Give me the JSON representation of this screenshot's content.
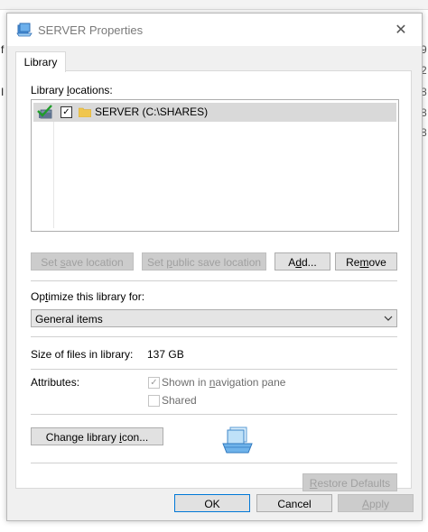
{
  "background_window": {
    "left_chars": [
      "f",
      "I"
    ],
    "right_chars": [
      "9",
      "2",
      "8",
      "8",
      "8"
    ]
  },
  "window": {
    "title": "SERVER Properties",
    "close_glyph": "✕"
  },
  "tabs": [
    {
      "label": "Library"
    }
  ],
  "library": {
    "locations_label_pre": "Library ",
    "locations_label_accel": "l",
    "locations_label_post": "ocations:",
    "items": [
      {
        "checked": true,
        "label": "SERVER (C:\\SHARES)"
      }
    ],
    "buttons": {
      "set_save_pre": "Set ",
      "set_save_accel": "s",
      "set_save_post": "ave location",
      "set_public_pre": "Set ",
      "set_public_accel": "p",
      "set_public_post": "ublic save location",
      "add_pre": "A",
      "add_accel": "d",
      "add_post": "d...",
      "remove_pre": "Re",
      "remove_accel": "m",
      "remove_post": "ove"
    }
  },
  "optimize": {
    "label_pre": "Op",
    "label_accel": "t",
    "label_post": "imize this library for:",
    "selected": "General items"
  },
  "size": {
    "label": "Size of files in library:",
    "value": "137 GB"
  },
  "attributes": {
    "label": "Attributes:",
    "shown_pre": "Shown in ",
    "shown_accel": "n",
    "shown_post": "avigation pane",
    "shown_checked": true,
    "shared_label": "Shared",
    "shared_checked": false
  },
  "change_icon_pre": "Change library ",
  "change_icon_accel": "i",
  "change_icon_post": "con...",
  "restore_pre": "",
  "restore_accel": "R",
  "restore_post": "estore Defaults",
  "footer": {
    "ok": "OK",
    "cancel": "Cancel",
    "apply_pre": "",
    "apply_accel": "A",
    "apply_post": "pply"
  },
  "colors": {
    "accent": "#0078d7",
    "dialog_bg": "#f0f0f0",
    "selection": "#d9d9d9",
    "disabled_text": "#a0a0a0"
  },
  "icons": [
    "library-icon",
    "close-icon",
    "green-check-library-icon",
    "folder-icon",
    "chevron-down-icon",
    "library-large-icon"
  ]
}
